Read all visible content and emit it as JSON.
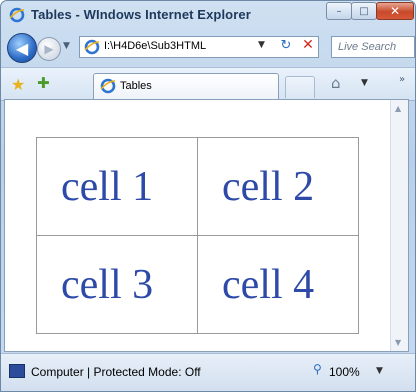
{
  "window": {
    "title": "Tables - WIndows Internet Explorer"
  },
  "caption_buttons": {
    "minimize": "–",
    "maximize": "□",
    "close": "✕"
  },
  "nav": {
    "back_glyph": "◀",
    "forward_glyph": "▶",
    "address": "I:\\H4D6e\\Sub3HTML",
    "search_placeholder": "Live Search"
  },
  "tab": {
    "label": "Tables"
  },
  "table": {
    "rows": [
      [
        "cell 1",
        "cell 2"
      ],
      [
        "cell 3",
        "cell 4"
      ]
    ]
  },
  "status": {
    "text": "Computer | Protected Mode: Off",
    "zoom": "100%"
  },
  "colors": {
    "cell_text": "#2e4aa8",
    "titlebar": "#cfe0f1",
    "close_button": "#c74a2a"
  },
  "icons": {
    "title": "ie-icon",
    "back": "back-arrow-icon",
    "forward": "forward-arrow-icon",
    "refresh": "refresh-icon",
    "stop": "stop-icon",
    "favorites": "favorites-star-icon",
    "add_favorites": "add-favorites-icon",
    "home": "home-icon",
    "status": "computer-icon",
    "zoom": "zoom-icon"
  }
}
